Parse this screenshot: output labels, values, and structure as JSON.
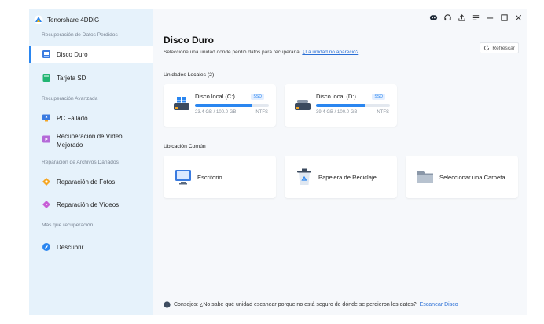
{
  "app": {
    "name": "Tenorshare 4DDiG"
  },
  "sidebar": {
    "sections": [
      {
        "label": "Recuperación de Datos Perdidos"
      },
      {
        "label": "Recuperación Avanzada"
      },
      {
        "label": "Reparación de Archivos Dañados"
      },
      {
        "label": "Más que recuperación"
      }
    ],
    "items": [
      {
        "label": "Disco Duro",
        "icon": "hard-drive-icon",
        "active": true
      },
      {
        "label": "Tarjeta SD",
        "icon": "sd-card-icon"
      },
      {
        "label": "PC Fallado",
        "icon": "crashed-pc-icon"
      },
      {
        "label": "Recuperación de Vídeo",
        "label2": "Mejorado",
        "icon": "video-recovery-icon"
      },
      {
        "label": "Reparación de Fotos",
        "icon": "photo-repair-icon"
      },
      {
        "label": "Reparación de Vídeos",
        "icon": "video-repair-icon"
      },
      {
        "label": "Descubrir",
        "icon": "discover-icon"
      }
    ]
  },
  "topbar": {
    "icons": [
      "chat-icon",
      "headset-icon",
      "upload-icon",
      "menu-icon",
      "minimize-icon",
      "maximize-icon",
      "close-icon"
    ]
  },
  "main": {
    "title": "Disco Duro",
    "subtitle": "Seleccione una unidad donde perdió datos para recuperarla.",
    "subtitle_link": "¿La unidad no apareció?",
    "refresh_label": "Refrescar",
    "local_label": "Unidades Locales (2)",
    "drives": [
      {
        "name": "Disco local (C:)",
        "badge": "SSD",
        "size": "23.4 GB / 100.0 GB",
        "fs": "NTFS",
        "used_fraction": 0.78
      },
      {
        "name": "Disco local (D:)",
        "badge": "SSD",
        "size": "39.4 GB / 100.0 GB",
        "fs": "NTFS",
        "used_fraction": 0.66
      }
    ],
    "common_label": "Ubicación Común",
    "locations": [
      {
        "label": "Escritorio",
        "icon": "desktop-icon"
      },
      {
        "label": "Papelera de Reciclaje",
        "icon": "recycle-bin-icon"
      },
      {
        "label": "Seleccionar una Carpeta",
        "icon": "folder-icon"
      }
    ],
    "tip_text": "Consejos: ¿No sabe qué unidad escanear porque no está seguro de dónde se perdieron los datos?",
    "tip_link": "Escanear Disco"
  },
  "colors": {
    "accent": "#2a86f0",
    "sidebar_bg": "#e6f2fb",
    "main_bg": "#f6f8fb"
  }
}
